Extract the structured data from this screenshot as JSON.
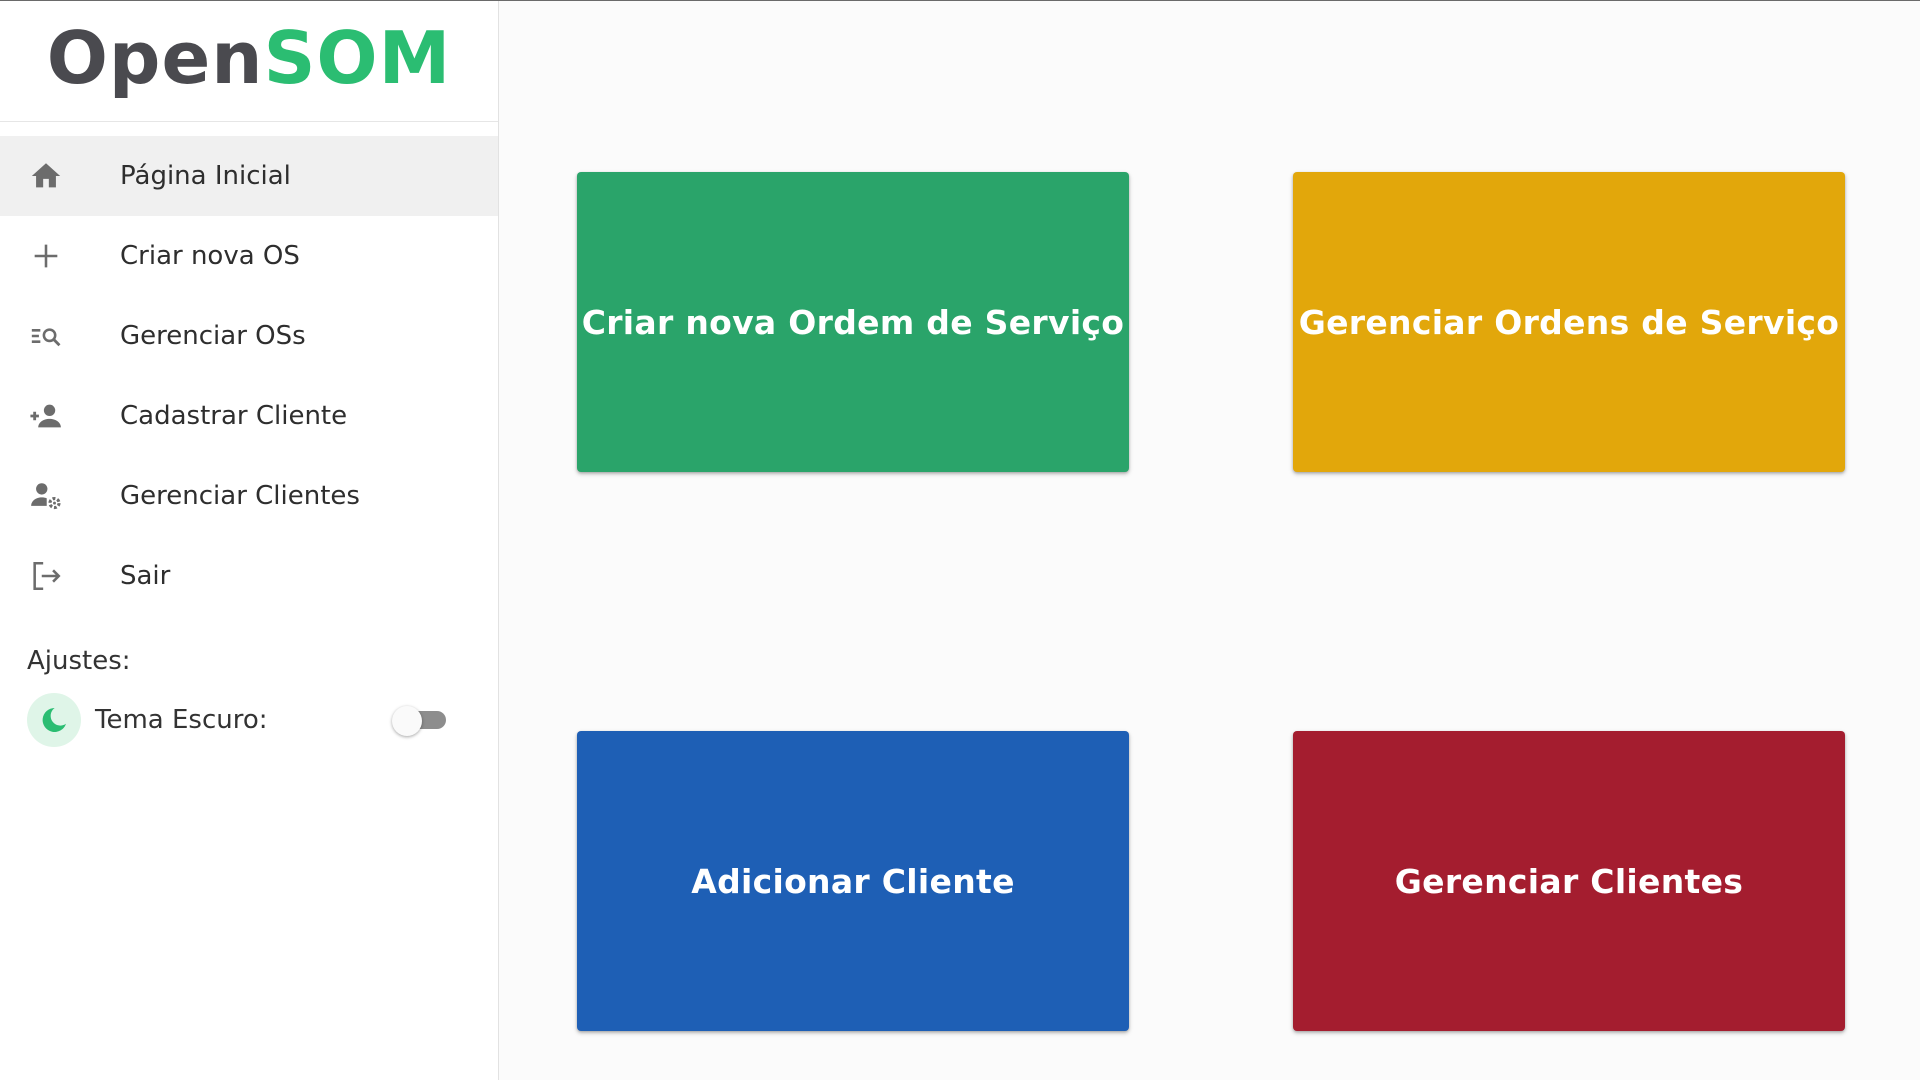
{
  "brand": {
    "part1": "Open",
    "part2": "SOM"
  },
  "sidebar": {
    "items": [
      {
        "label": "Página Inicial",
        "icon": "home-icon",
        "active": true
      },
      {
        "label": "Criar nova OS",
        "icon": "plus-icon"
      },
      {
        "label": "Gerenciar OSs",
        "icon": "list-search-icon"
      },
      {
        "label": "Cadastrar Cliente",
        "icon": "person-add-icon"
      },
      {
        "label": "Gerenciar Clientes",
        "icon": "person-gear-icon"
      },
      {
        "label": "Sair",
        "icon": "logout-icon"
      }
    ],
    "settings": {
      "title": "Ajustes:",
      "dark_theme_label": "Tema Escuro:",
      "dark_theme_enabled": false
    }
  },
  "main": {
    "cards": [
      {
        "label": "Criar nova Ordem de Serviço",
        "color": "#2aa46a"
      },
      {
        "label": "Gerenciar Ordens de Serviço",
        "color": "#e2a70b"
      },
      {
        "label": "Adicionar Cliente",
        "color": "#1e5fb5"
      },
      {
        "label": "Gerenciar Clientes",
        "color": "#a41d2f"
      }
    ]
  },
  "colors": {
    "brand_accent": "#2bbd72",
    "brand_dark": "#4a4a4f"
  }
}
